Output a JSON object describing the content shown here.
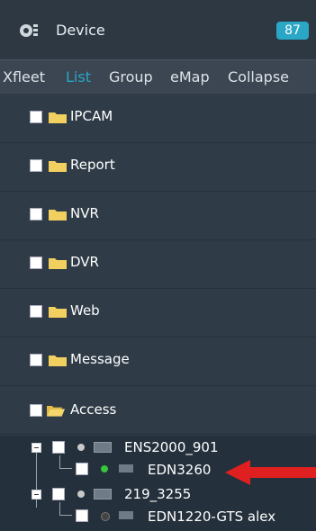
{
  "header": {
    "title": "Device",
    "count": "87"
  },
  "tabs": [
    {
      "label": "Xfleet",
      "active": false
    },
    {
      "label": "List",
      "active": true
    },
    {
      "label": "Group",
      "active": false
    },
    {
      "label": "eMap",
      "active": false
    },
    {
      "label": "Collapse",
      "active": false
    }
  ],
  "folders": [
    "IPCAM",
    "Report",
    "NVR",
    "DVR",
    "Web",
    "Message",
    "Access"
  ],
  "tree": [
    {
      "label": "ENS2000_901",
      "status_color": "#c9c9c9"
    },
    {
      "label": "EDN3260",
      "status_color": "#38c43b"
    },
    {
      "label": "219_3255",
      "status_color": "#c9c9c9"
    },
    {
      "label": "EDN1220-GTS alex",
      "status_color": "#444444"
    }
  ],
  "colors": {
    "accent": "#2aa6c6",
    "highlight_arrow": "#e02020"
  },
  "icons": {
    "device": "device-icon",
    "folder": "folder-icon",
    "arrow": "red-arrow-icon"
  }
}
